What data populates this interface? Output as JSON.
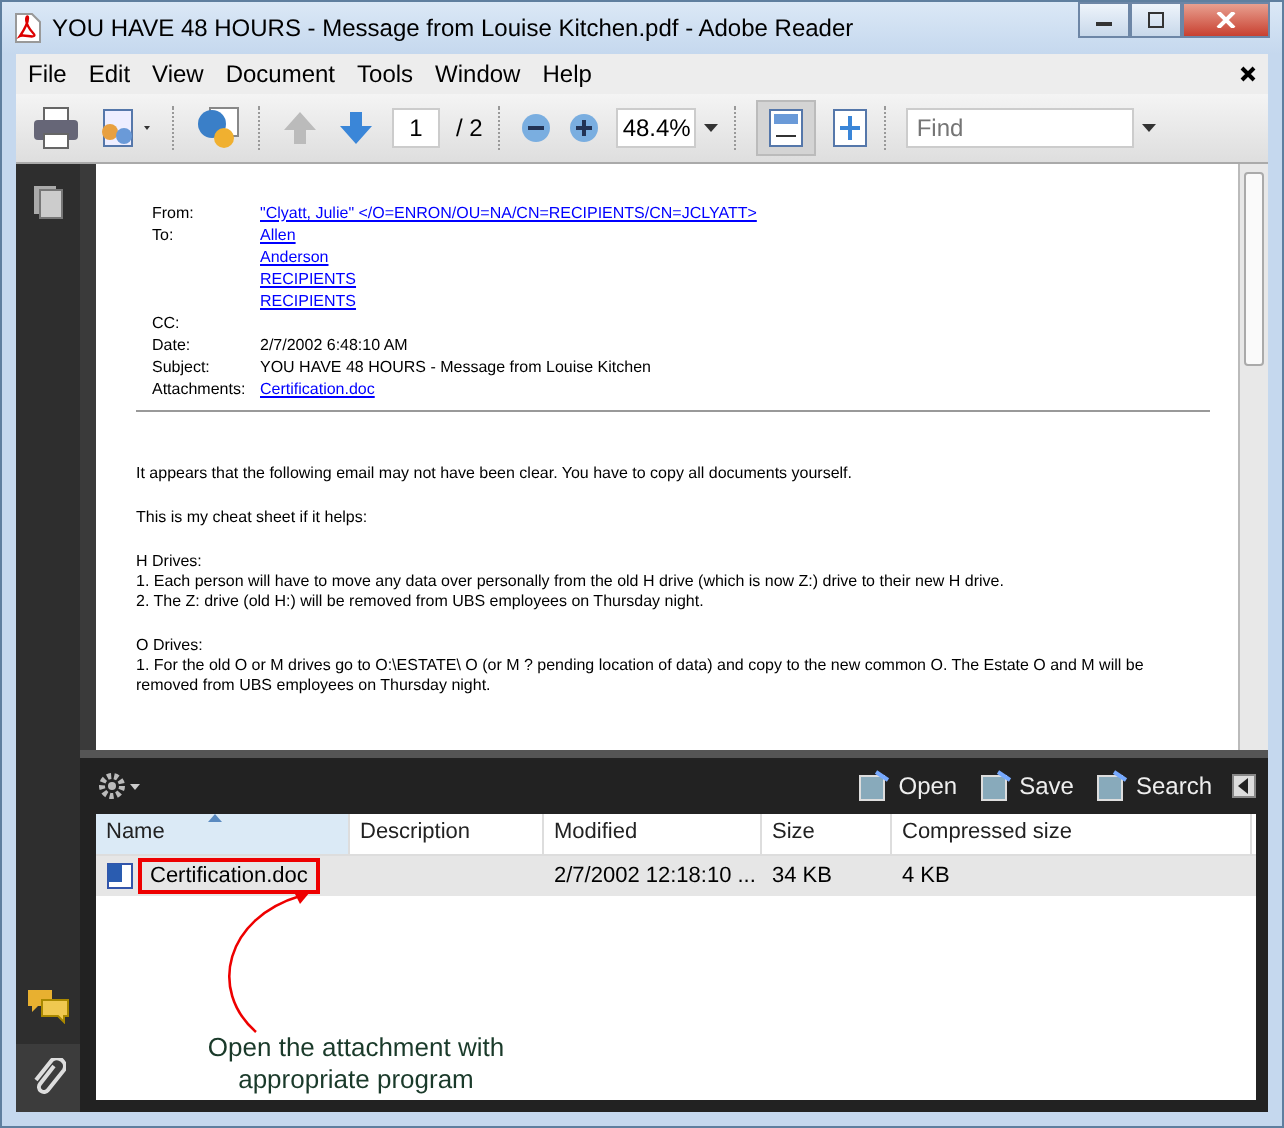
{
  "window": {
    "title": "YOU HAVE 48 HOURS - Message from Louise Kitchen.pdf - Adobe Reader"
  },
  "menu": [
    "File",
    "Edit",
    "View",
    "Document",
    "Tools",
    "Window",
    "Help"
  ],
  "toolbar": {
    "page_current": "1",
    "page_total": "/ 2",
    "zoom": "48.4%",
    "find_placeholder": "Find"
  },
  "document": {
    "header_fields": [
      {
        "label": "From:",
        "values": [
          {
            "text": "\"Clyatt, Julie\" </O=ENRON/OU=NA/CN=RECIPIENTS/CN=JCLYATT>",
            "link": true
          }
        ]
      },
      {
        "label": "To:",
        "values": [
          {
            "text": "Allen",
            "link": true
          },
          {
            "text": "Anderson",
            "link": true
          },
          {
            "text": "RECIPIENTS",
            "link": true
          },
          {
            "text": "RECIPIENTS",
            "link": true
          }
        ]
      },
      {
        "label": "CC:"
      },
      {
        "label": "Date:",
        "values": [
          {
            "text": "2/7/2002 6:48:10 AM",
            "link": false
          }
        ]
      },
      {
        "label": "Subject:",
        "values": [
          {
            "text": "YOU HAVE 48 HOURS - Message from Louise Kitchen",
            "link": false
          }
        ]
      },
      {
        "label": "Attachments:",
        "values": [
          {
            "text": "Certification.doc",
            "link": true
          }
        ]
      }
    ],
    "paragraphs": [
      [
        "It appears that the following email may not have been clear. You have to copy all documents yourself."
      ],
      [
        "This is my cheat sheet if it helps:"
      ],
      [
        "H Drives:",
        "1. Each person will have to move any data over personally from the old H drive (which is now Z:) drive to their new H drive.",
        "2. The Z: drive (old H:) will be removed from UBS employees on Thursday night."
      ],
      [
        "O Drives:",
        "1. For the old O or M drives go to O:\\ESTATE\\ O (or M ? pending location of data) and copy to the new common O. The Estate O and M will be removed from UBS employees on Thursday night."
      ]
    ]
  },
  "attachments": {
    "actions": [
      "Open",
      "Save",
      "Search"
    ],
    "columns": [
      {
        "label": "Name",
        "sorted": true
      },
      {
        "label": "Description",
        "sorted": false
      },
      {
        "label": "Modified",
        "sorted": false
      },
      {
        "label": "Size",
        "sorted": false
      },
      {
        "label": "Compressed size",
        "sorted": false
      }
    ],
    "rows": [
      {
        "cells": [
          "Certification.doc",
          "",
          "2/7/2002 12:18:10 ...",
          "34 KB",
          "4 KB"
        ],
        "selected": true
      }
    ],
    "annotation": "Open the attachment with appropriate program"
  }
}
